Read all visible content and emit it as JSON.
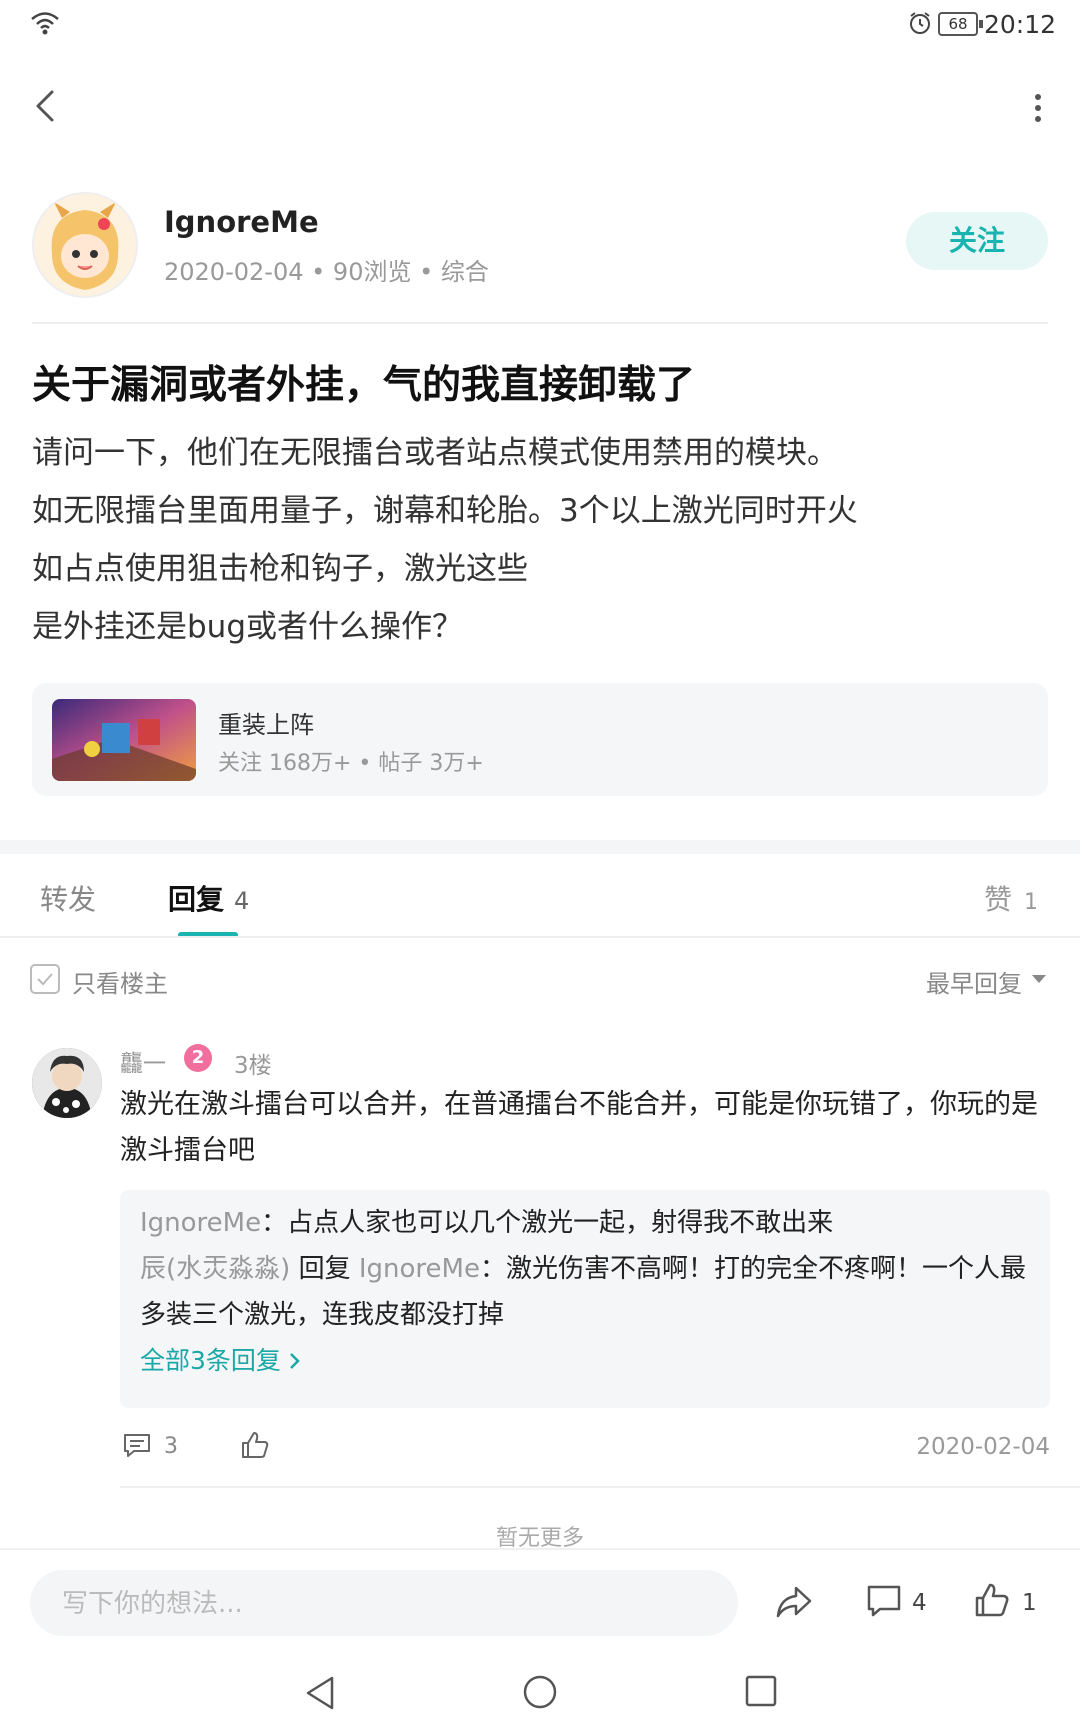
{
  "status": {
    "battery": "68",
    "time": "20:12"
  },
  "author": {
    "name": "IgnoreMe",
    "date": "2020-02-04",
    "views": "90浏览",
    "category": "综合"
  },
  "follow_label": "关注",
  "post": {
    "title": "关于漏洞或者外挂，气的我直接卸载了",
    "lines": [
      "请问一下，他们在无限擂台或者站点模式使用禁用的模块。",
      "如无限擂台里面用量子，谢幕和轮胎。3个以上激光同时开火",
      "如占点使用狙击枪和钩子，激光这些",
      "是外挂还是bug或者什么操作？"
    ]
  },
  "game": {
    "name": "重装上阵",
    "follows": "关注 168万+",
    "posts": "帖子 3万+"
  },
  "tabs": {
    "forward": "转发",
    "reply": "回复",
    "reply_count": "4",
    "like": "赞",
    "like_count": "1"
  },
  "filter": {
    "only_owner": "只看楼主",
    "sort": "最早回复"
  },
  "comment": {
    "user": "龘一",
    "badge": "2",
    "floor": "3楼",
    "text": "激光在激斗擂台可以合并，在普通擂台不能合并，可能是你玩错了，你玩的是激斗擂台吧",
    "replies": [
      {
        "name": "IgnoreMe",
        "sep": "：",
        "text": "占点人家也可以几个激光一起，射得我不敢出来"
      },
      {
        "name": "辰(水㶣淼淼)",
        "reply_word": "回复",
        "target": "IgnoreMe",
        "sep": "：",
        "text": "激光伤害不高啊！打的完全不疼啊！一个人最多装三个激光，连我皮都没打掉"
      }
    ],
    "see_all": "全部3条回复",
    "reply_count": "3",
    "date": "2020-02-04"
  },
  "no_more": "暂无更多",
  "bottom": {
    "placeholder": "写下你的想法...",
    "comment_count": "4",
    "like_count": "1"
  },
  "colors": {
    "accent": "#19b3b0",
    "badge": "#f06f9c"
  },
  "icons": [
    "wifi-icon",
    "alarm-icon",
    "battery-icon",
    "back-icon",
    "more-icon",
    "share-icon",
    "comment-icon",
    "like-icon"
  ]
}
